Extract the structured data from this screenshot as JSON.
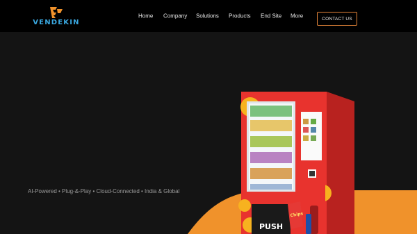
{
  "brand": {
    "name": "VENDEKIN"
  },
  "nav": {
    "items": [
      {
        "label": "Home"
      },
      {
        "label": "Company"
      },
      {
        "label": "Solutions"
      },
      {
        "label": "Products"
      },
      {
        "label": "End Site"
      },
      {
        "label": "More"
      }
    ],
    "cta_label": "CONTACT US"
  },
  "hero": {
    "tagline": "AI-Powered • Plug-&-Play • Cloud-Connected • India & Global",
    "machine": {
      "push_label": "PUSH",
      "chips_label": "Chips"
    }
  },
  "colors": {
    "accent": "#f0922b",
    "brand_blue": "#3aa8e0",
    "machine_red": "#e8332e",
    "background": "#141414"
  }
}
